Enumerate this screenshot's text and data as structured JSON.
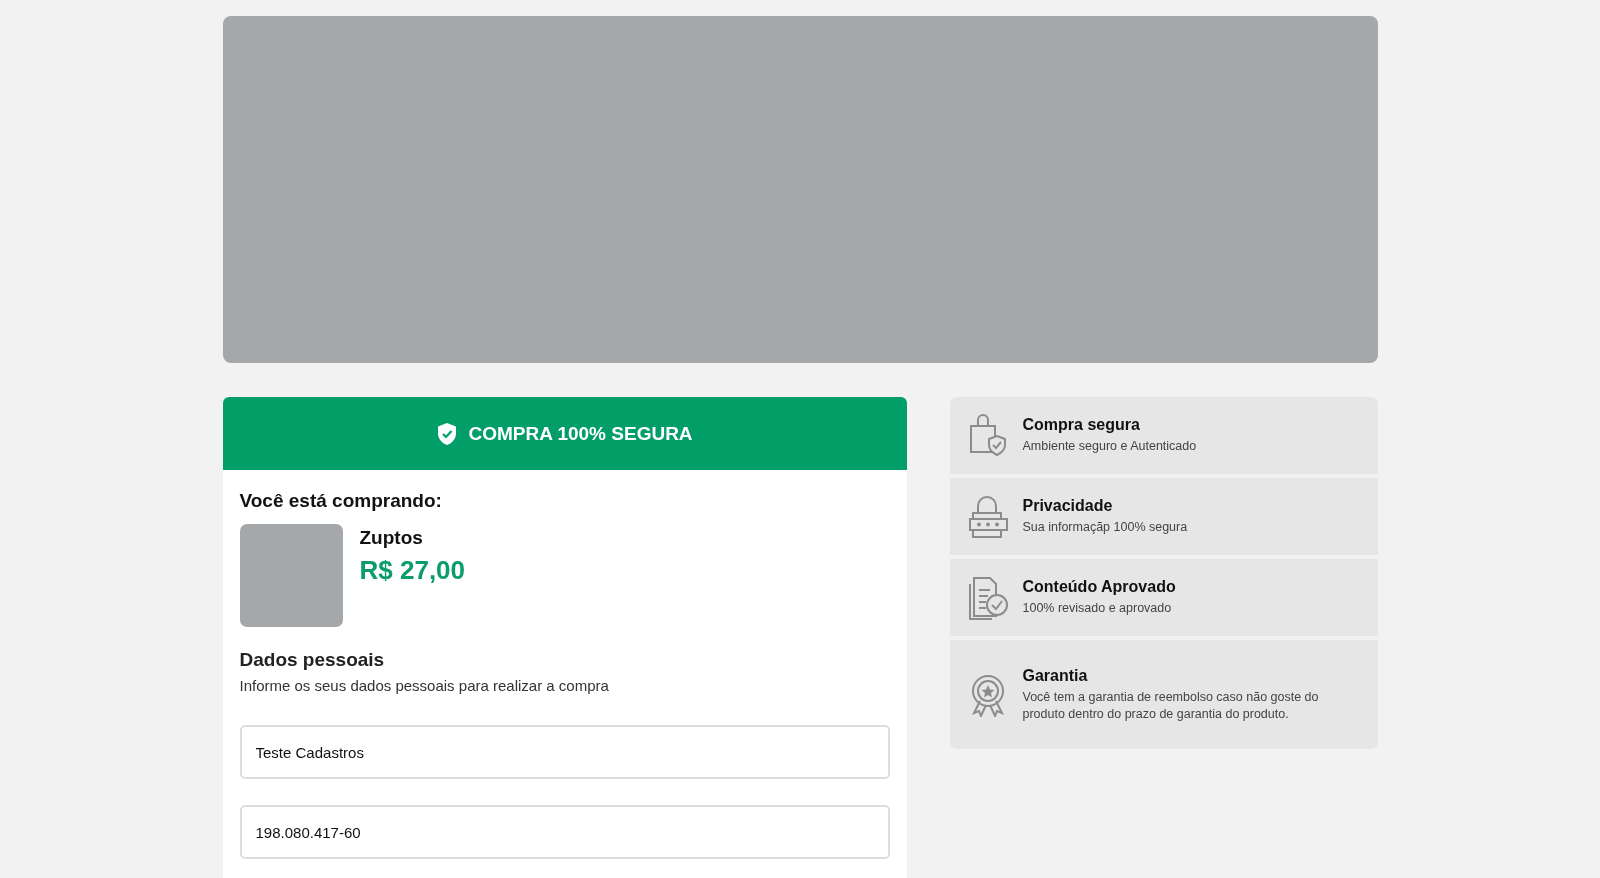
{
  "secure_header": {
    "label": "COMPRA 100% SEGURA"
  },
  "purchase": {
    "heading": "Você está comprando:",
    "product_name": "Zuptos",
    "price": "R$ 27,00"
  },
  "personal_data": {
    "title": "Dados pessoais",
    "subtitle": "Informe os seus dados pessoais para realizar a compra",
    "fields": [
      {
        "value": "Teste Cadastros"
      },
      {
        "value": "198.080.417-60"
      }
    ]
  },
  "features": [
    {
      "kind": "bag",
      "title": "Compra segura",
      "text": "Ambiente seguro e Autenticado"
    },
    {
      "kind": "lock",
      "title": "Privacidade",
      "text": "Sua informaçãp 100% segura"
    },
    {
      "kind": "document",
      "title": "Conteúdo Aprovado",
      "text": "100% revisado e aprovado"
    },
    {
      "kind": "medal",
      "title": "Garantia",
      "text": "Você tem a garantia de reembolso caso não goste do produto dentro do prazo de garantia do produto."
    }
  ]
}
